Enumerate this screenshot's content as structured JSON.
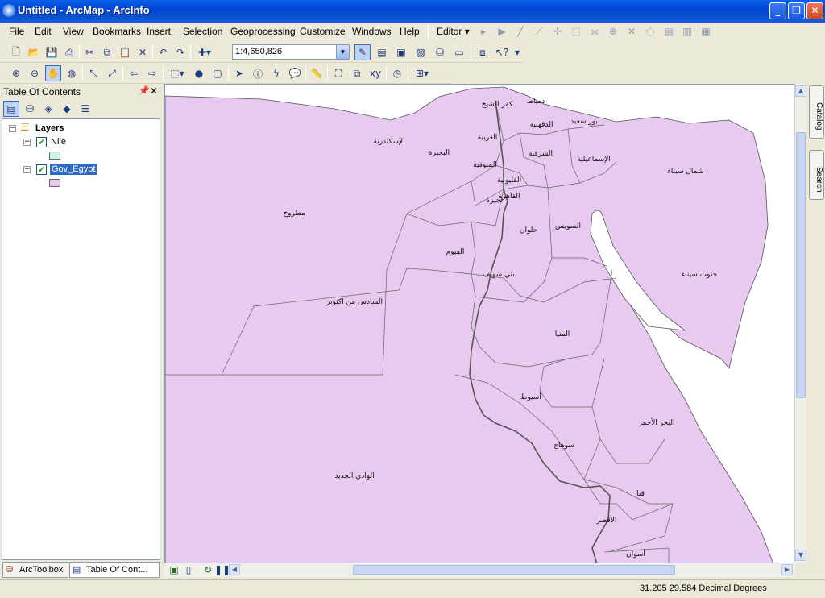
{
  "window": {
    "title": "Untitled - ArcMap - ArcInfo"
  },
  "menu": {
    "items": [
      "File",
      "Edit",
      "View",
      "Bookmarks",
      "Insert",
      "Selection",
      "Geoprocessing",
      "Customize",
      "Windows",
      "Help"
    ]
  },
  "editor": {
    "label": "Editor"
  },
  "scale": {
    "value": "1:4,650,826"
  },
  "toc": {
    "title": "Table Of Contents",
    "root": "Layers",
    "layers": [
      {
        "name": "Nile",
        "checked": "✔",
        "color": "#c8f2e6"
      },
      {
        "name": "Gov_Egypt",
        "checked": "✔",
        "color": "#e8c9ef"
      }
    ]
  },
  "tabs": {
    "arctoolbox": "ArcToolbox",
    "toc": "Table Of Cont..."
  },
  "dock": {
    "catalog": "Catalog",
    "search": "Search"
  },
  "status": {
    "coords": "31.205  29.584 Decimal Degrees"
  },
  "map": {
    "fill": "#e8c9ef",
    "labels": [
      "كفر الشيخ",
      "دمياط",
      "الدقهلية",
      "بور سعيد",
      "الإسكندرية",
      "الغربية",
      "البحيرة",
      "الشرقية",
      "المنوفية",
      "الإسماعيلية",
      "شمال سيناء",
      "القليوبية",
      "القاهرة",
      "الجيزة",
      "مطروح",
      "السويس",
      "حلوان",
      "الفيوم",
      "بني سويف",
      "جنوب سيناء",
      "السادس من اكتوبر",
      "المنيا",
      "أسيوط",
      "البحر الأحمر",
      "سوهاج",
      "الوادي الجديد",
      "قنا",
      "الأقصر",
      "أسوان"
    ]
  }
}
